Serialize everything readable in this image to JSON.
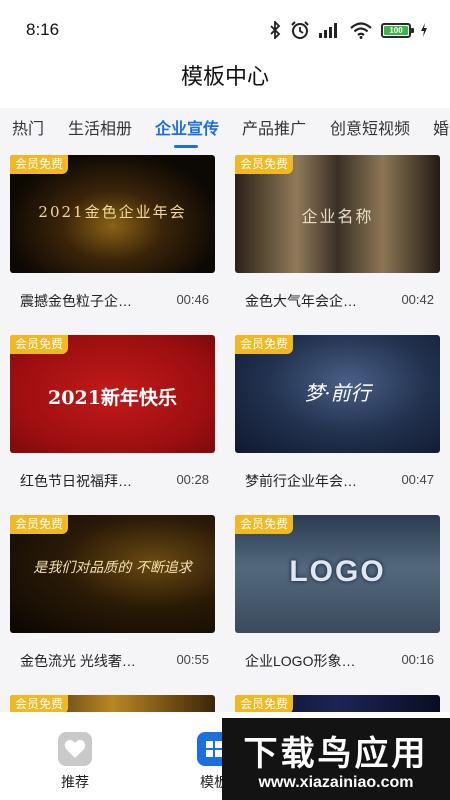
{
  "status": {
    "time": "8:16",
    "battery": "100",
    "icons": [
      "bluetooth-icon",
      "alarm-icon",
      "signal-icon",
      "wifi-icon",
      "battery-icon",
      "charging-icon"
    ]
  },
  "page": {
    "title": "模板中心"
  },
  "tabs": [
    {
      "label": "热门",
      "active": false
    },
    {
      "label": "生活相册",
      "active": false
    },
    {
      "label": "企业宣传",
      "active": true
    },
    {
      "label": "产品推广",
      "active": false
    },
    {
      "label": "创意短视频",
      "active": false
    },
    {
      "label": "婚",
      "active": false
    }
  ],
  "colors": {
    "accent": "#1d6fe0",
    "badge": "#f2b821",
    "background": "#f5f5f7"
  },
  "cards": [
    {
      "badge": "会员免费",
      "title": "震撼金色粒子企…",
      "duration": "00:46",
      "thumb_text": "2021金色企业年会"
    },
    {
      "badge": "会员免费",
      "title": "金色大气年会企…",
      "duration": "00:42",
      "thumb_text": "企业名称"
    },
    {
      "badge": "会员免费",
      "title": "红色节日祝福拜…",
      "duration": "00:28",
      "thumb_text": "2021新年快乐"
    },
    {
      "badge": "会员免费",
      "title": "梦前行企业年会…",
      "duration": "00:47",
      "thumb_text": "梦·前行"
    },
    {
      "badge": "会员免费",
      "title": "金色流光 光线奢…",
      "duration": "00:55",
      "thumb_text": "是我们对品质的 不断追求"
    },
    {
      "badge": "会员免费",
      "title": "企业LOGO形象…",
      "duration": "00:16",
      "thumb_text": "LOGO"
    },
    {
      "badge": "会员免费"
    },
    {
      "badge": "会员免费"
    }
  ],
  "nav": [
    {
      "label": "推荐",
      "icon": "heart-icon"
    },
    {
      "label": "模板",
      "icon": "template-icon"
    }
  ],
  "watermark": {
    "title": "下载鸟应用",
    "url": "www.xiazainiao.com"
  }
}
